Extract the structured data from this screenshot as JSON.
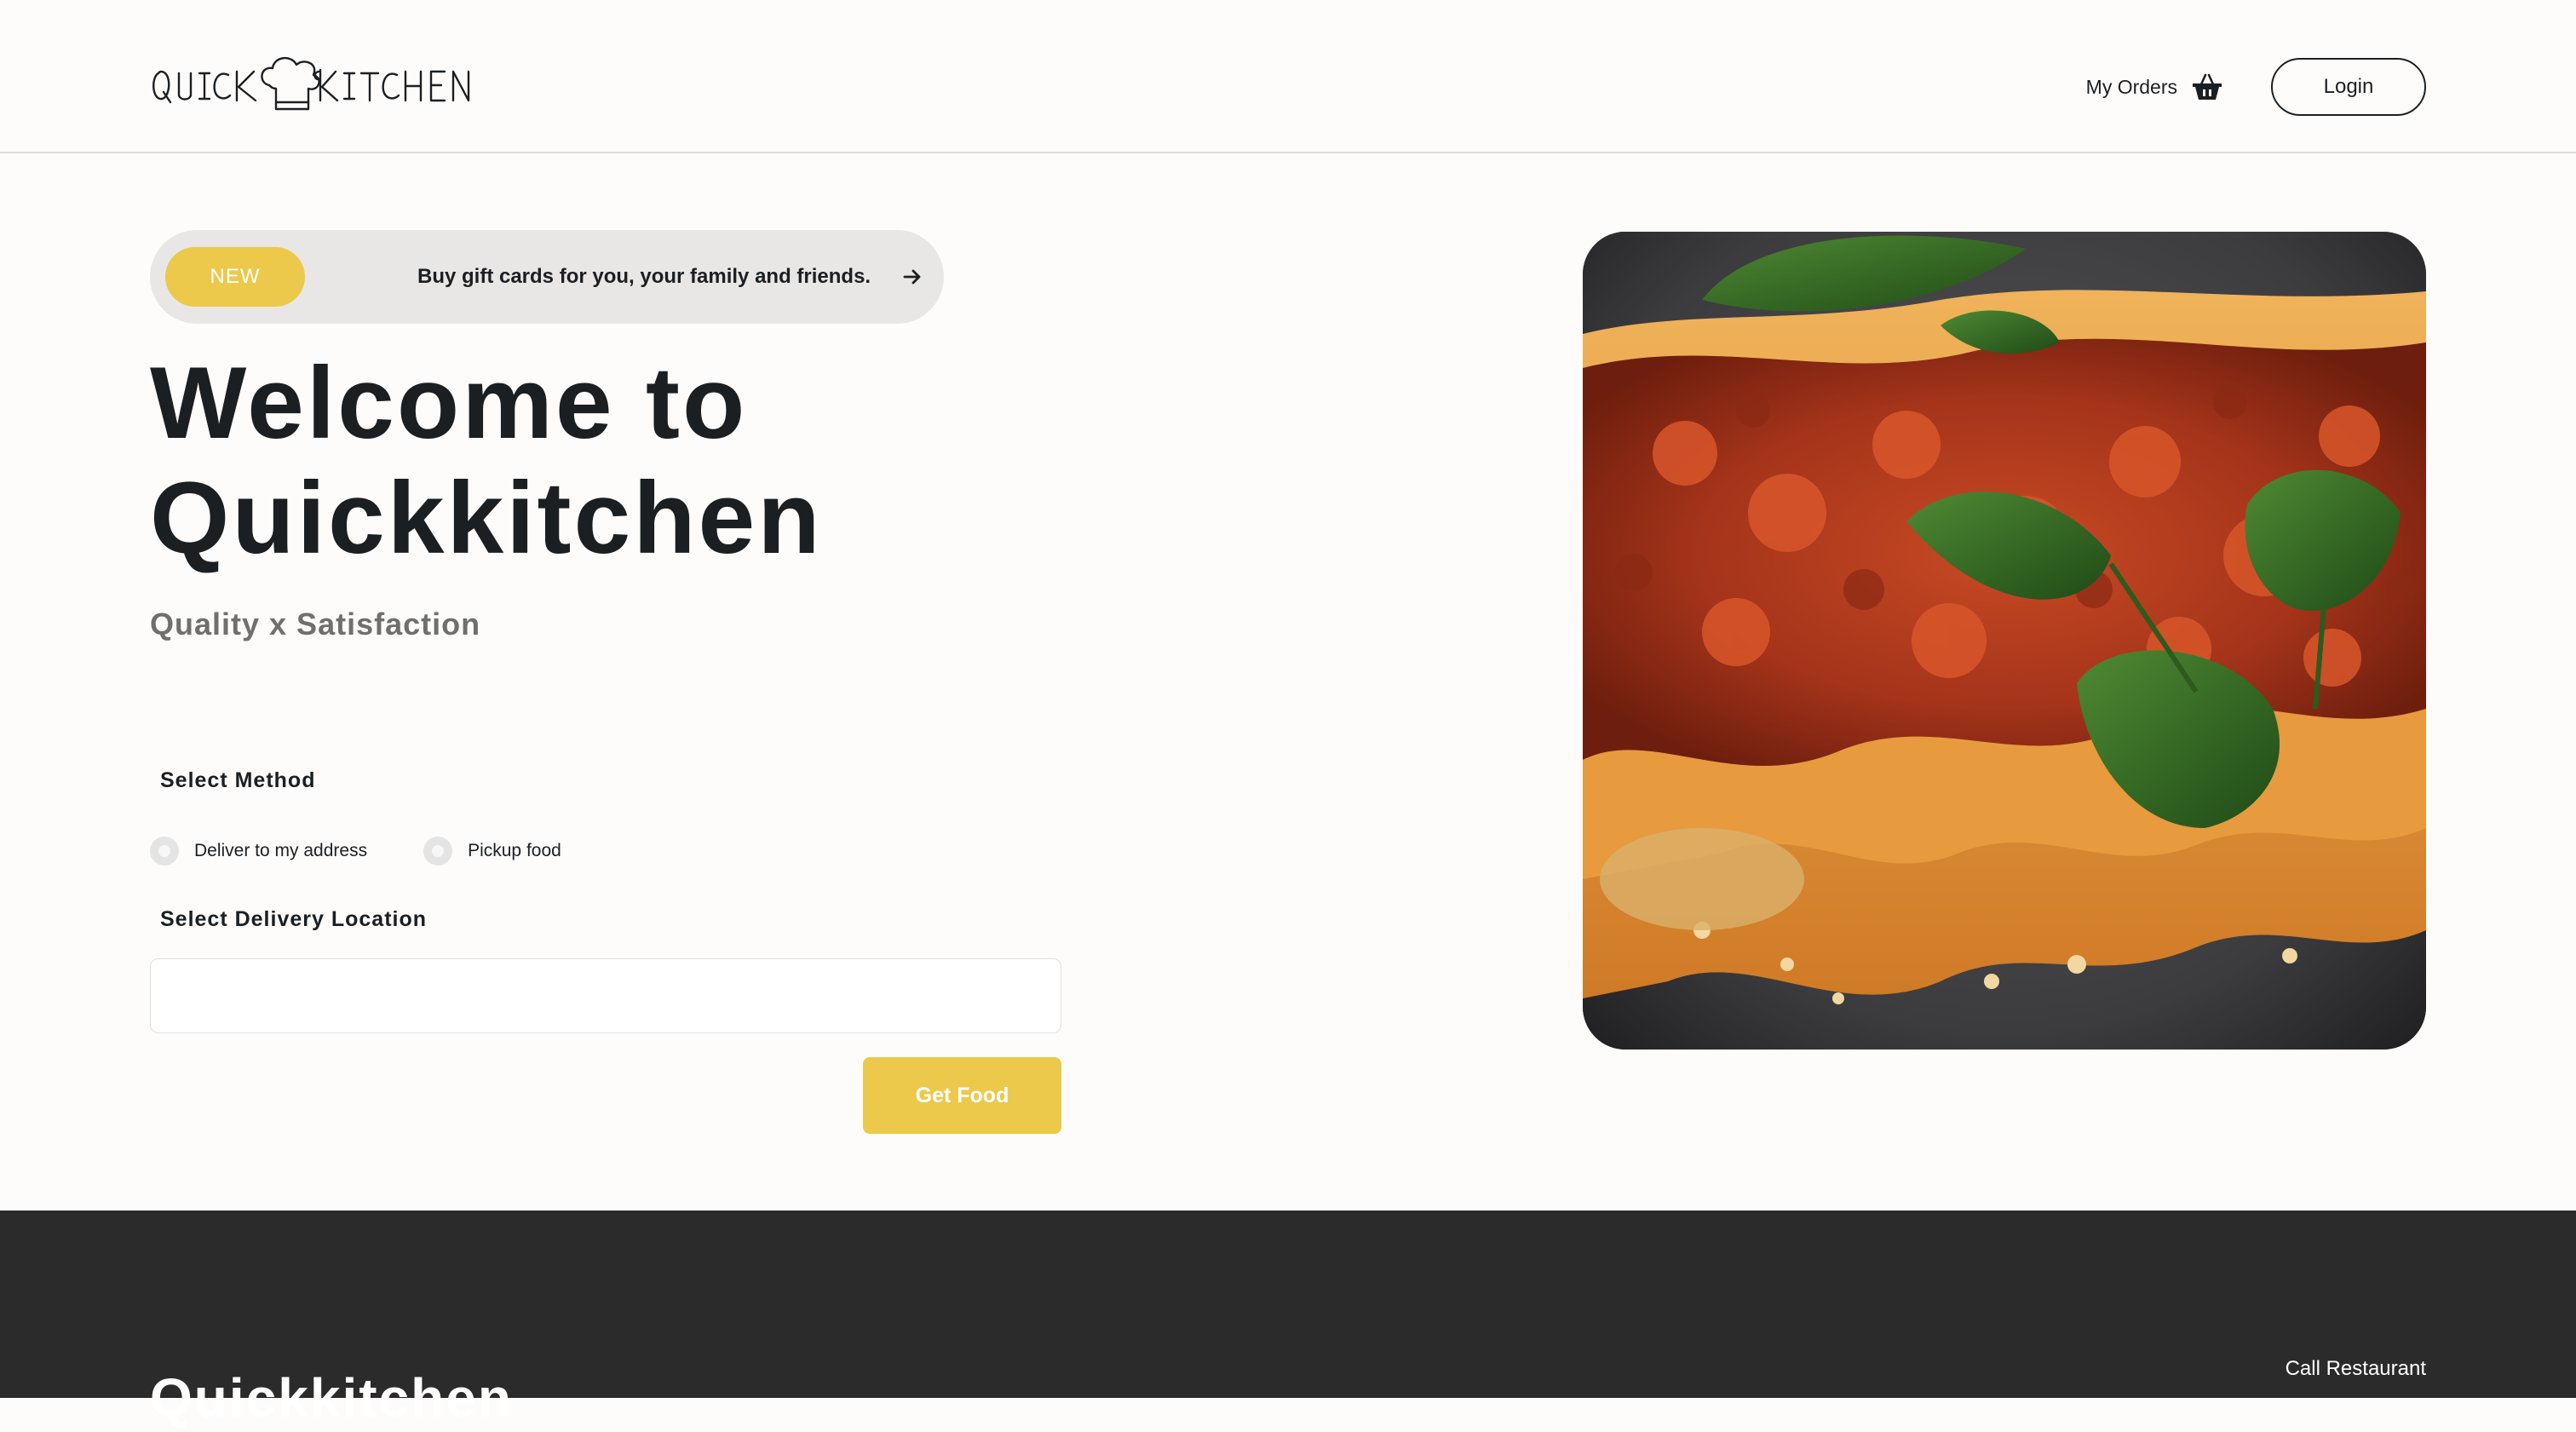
{
  "header": {
    "logo_text": "QUICKKITCHEN",
    "my_orders_label": "My Orders",
    "orders_icon": "basket-icon",
    "login_label": "Login"
  },
  "promo": {
    "badge": "NEW",
    "text": "Buy gift cards for you, your family and friends.",
    "arrow_icon": "arrow-right-icon"
  },
  "hero": {
    "title_line1": "Welcome to",
    "title_line2": "Quickkitchen",
    "subtitle": "Quality x Satisfaction"
  },
  "order_form": {
    "method_label": "Select Method",
    "methods": [
      {
        "label": "Deliver to my address",
        "selected": false
      },
      {
        "label": "Pickup food",
        "selected": false
      }
    ],
    "location_label": "Select Delivery Location",
    "location_value": "",
    "location_placeholder": "",
    "submit_label": "Get Food"
  },
  "hero_image": {
    "subject": "lasagna with basil leaves"
  },
  "footer": {
    "brand": "Quickkitchen",
    "call_label": "Call Restaurant"
  },
  "colors": {
    "accent": "#ecc94b",
    "text_dark": "#1c1f22",
    "subtitle_gray": "#6f6f6f",
    "promo_bg": "#e9e7e5",
    "page_bg": "#fdfcfb",
    "footer_bg": "#2b2b2c"
  }
}
